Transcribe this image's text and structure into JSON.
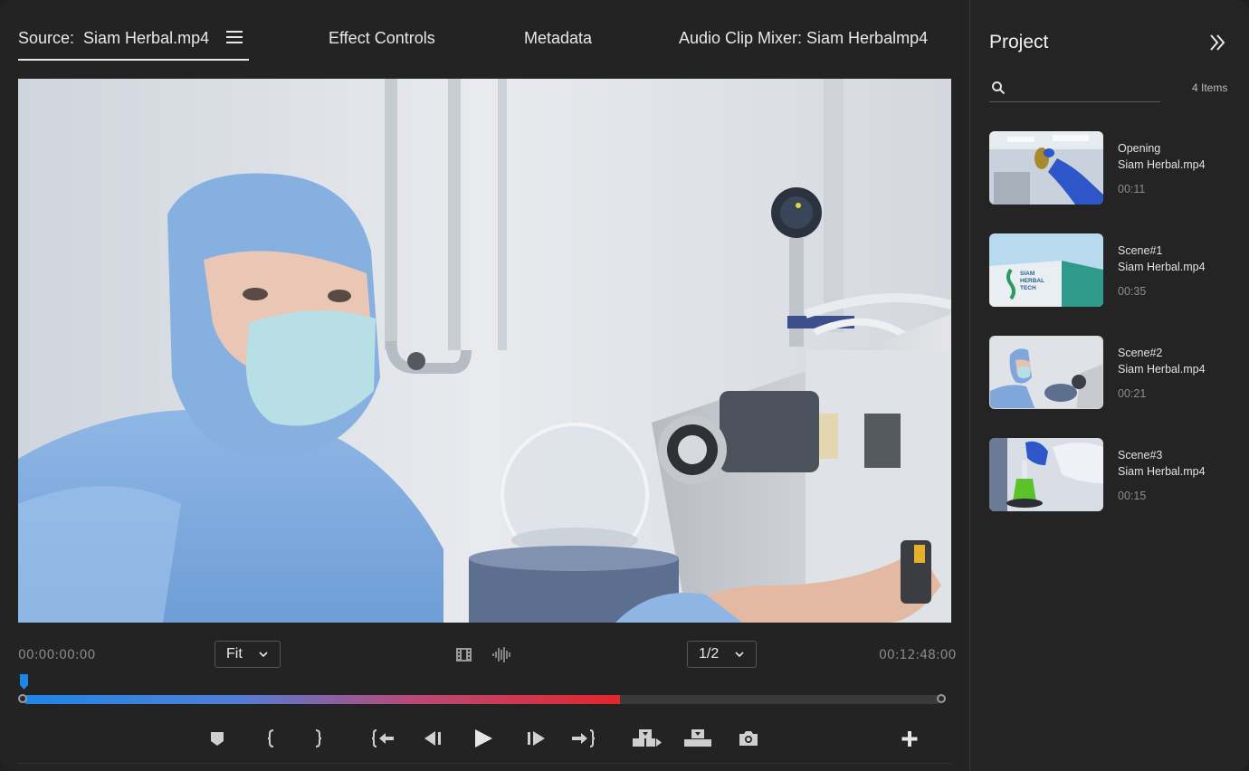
{
  "source_panel": {
    "tabs": {
      "source_label": "Source:",
      "source_file": "Siam Herbal.mp4",
      "effect_controls": "Effect Controls",
      "metadata": "Metadata",
      "audio_mixer": "Audio Clip Mixer: Siam Herbalmp4"
    },
    "timecode_in": "00:00:00:00",
    "timecode_out": "00:12:48:00",
    "zoom_select": "Fit",
    "resolution_select": "1/2",
    "playback_progress": 0.65,
    "colors": {
      "progress_start": "#1f86e6",
      "progress_end": "#e3262a",
      "playhead": "#1f86e6"
    },
    "controls": [
      "add-marker-icon",
      "mark-in-icon",
      "mark-out-icon",
      "go-to-in-icon",
      "step-back-icon",
      "play-icon",
      "step-forward-icon",
      "go-to-out-icon",
      "insert-icon",
      "overwrite-icon",
      "export-frame-icon",
      "add-button-icon"
    ]
  },
  "project_panel": {
    "title": "Project",
    "search_placeholder": "",
    "items_count": "4 Items",
    "clips": [
      {
        "title": "Opening",
        "file": "Siam Herbal.mp4",
        "duration": "00:11"
      },
      {
        "title": "Scene#1",
        "file": "Siam Herbal.mp4",
        "duration": "00:35"
      },
      {
        "title": "Scene#2",
        "file": "Siam Herbal.mp4",
        "duration": "00:21"
      },
      {
        "title": "Scene#3",
        "file": "Siam Herbal.mp4",
        "duration": "00:15"
      }
    ],
    "thumbnail_3_sign": [
      "SIAM",
      "HERBAL",
      "TECH"
    ]
  }
}
